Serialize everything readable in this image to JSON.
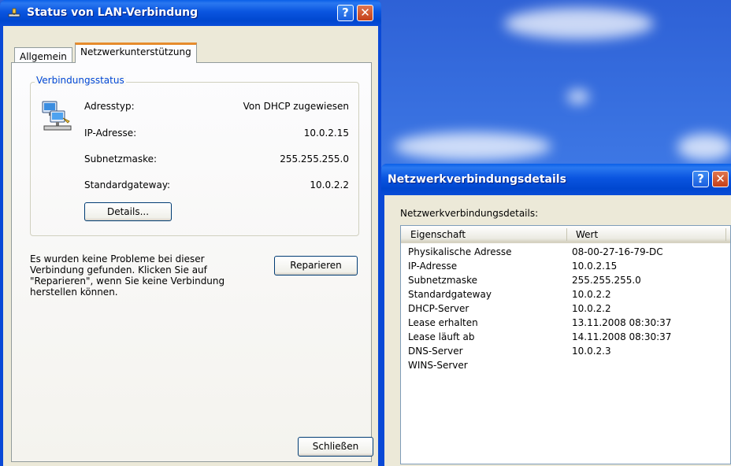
{
  "window1": {
    "title": "Status von LAN-Verbindung",
    "help_label": "?",
    "close_label": "✕",
    "tabs": [
      {
        "label": "Allgemein",
        "active": false
      },
      {
        "label": "Netzwerkunterstützung",
        "active": true
      }
    ],
    "group_title": "Verbindungsstatus",
    "rows": [
      {
        "label": "Adresstyp:",
        "value": "Von DHCP zugewiesen"
      },
      {
        "label": "IP-Adresse:",
        "value": "10.0.2.15"
      },
      {
        "label": "Subnetzmaske:",
        "value": "255.255.255.0"
      },
      {
        "label": "Standardgateway:",
        "value": "10.0.2.2"
      }
    ],
    "details_button": "Details...",
    "message": "Es wurden keine Probleme bei dieser Verbindung gefunden. Klicken Sie auf \"Reparieren\", wenn Sie keine Verbindung herstellen können.",
    "repair_button": "Reparieren",
    "close_button": "Schließen",
    "icon": "network-connection-icon"
  },
  "window2": {
    "title": "Netzwerkverbindungsdetails",
    "help_label": "?",
    "close_label": "✕",
    "label": "Netzwerkverbindungsdetails:",
    "columns": [
      "Eigenschaft",
      "Wert"
    ],
    "rows": [
      {
        "property": "Physikalische Adresse",
        "value": "08-00-27-16-79-DC"
      },
      {
        "property": "IP-Adresse",
        "value": "10.0.2.15"
      },
      {
        "property": "Subnetzmaske",
        "value": "255.255.255.0"
      },
      {
        "property": "Standardgateway",
        "value": "10.0.2.2"
      },
      {
        "property": "DHCP-Server",
        "value": "10.0.2.2"
      },
      {
        "property": "Lease erhalten",
        "value": "13.11.2008 08:30:37"
      },
      {
        "property": "Lease läuft ab",
        "value": "14.11.2008 08:30:37"
      },
      {
        "property": "DNS-Server",
        "value": "10.0.2.3"
      },
      {
        "property": "WINS-Server",
        "value": ""
      }
    ]
  },
  "colors": {
    "titlebar": "#0a55e0",
    "dialog_face": "#ece9d8",
    "group_title": "#0046d5",
    "tab_highlight": "#e68b2c",
    "close_button": "#c4401a"
  }
}
